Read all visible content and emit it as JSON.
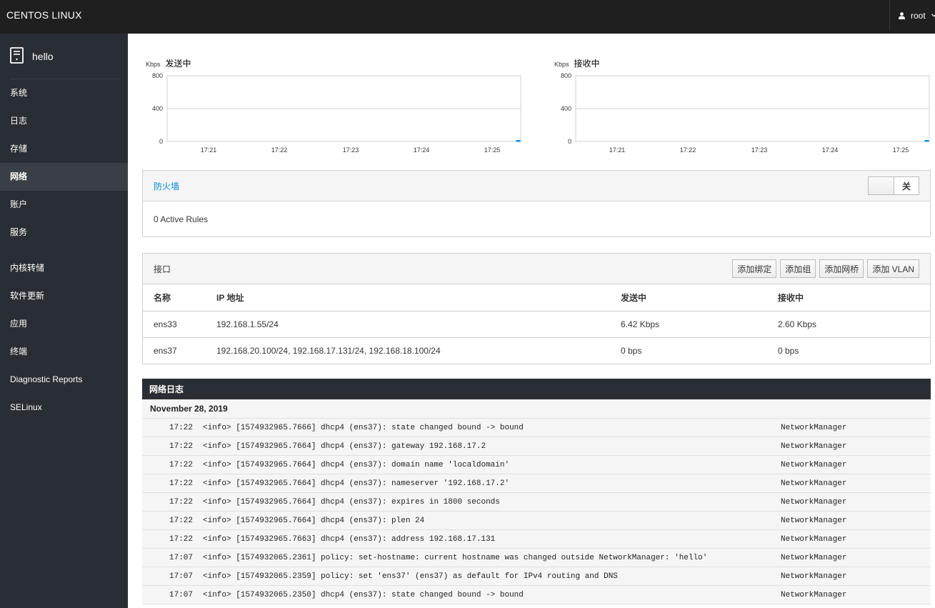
{
  "topbar": {
    "brand": "CENTOS LINUX",
    "user": "root"
  },
  "sidebar": {
    "host": "hello",
    "items": [
      "系统",
      "日志",
      "存储",
      "网络",
      "账户",
      "服务",
      "内核转储",
      "软件更新",
      "应用",
      "终端",
      "Diagnostic Reports",
      "SELinux"
    ],
    "active_index": 3
  },
  "charts": [
    {
      "unit": "Kbps",
      "title": "发送中",
      "chart_data": {
        "type": "area",
        "x": [
          "17:21",
          "17:22",
          "17:23",
          "17:24",
          "17:25"
        ],
        "yticks": [
          "800",
          "400",
          "0"
        ],
        "ylim": [
          0,
          800
        ],
        "grid": true,
        "values": [
          0,
          0,
          0,
          0,
          0,
          6.42
        ]
      }
    },
    {
      "unit": "Kbps",
      "title": "接收中",
      "chart_data": {
        "type": "area",
        "x": [
          "17:21",
          "17:22",
          "17:23",
          "17:24",
          "17:25"
        ],
        "yticks": [
          "800",
          "400",
          "0"
        ],
        "ylim": [
          0,
          800
        ],
        "grid": true,
        "values": [
          0,
          0,
          0,
          0,
          0,
          2.6
        ]
      }
    }
  ],
  "firewall": {
    "title": "防火墙",
    "toggle_label": "关",
    "rules": "0 Active Rules"
  },
  "interfaces": {
    "title": "接口",
    "buttons": [
      "添加绑定",
      "添加组",
      "添加网桥",
      "添加 VLAN"
    ],
    "columns": [
      "名称",
      "IP 地址",
      "发送中",
      "接收中"
    ],
    "rows": [
      [
        "ens33",
        "192.168.1.55/24",
        "6.42 Kbps",
        "2.60 Kbps"
      ],
      [
        "ens37",
        "192.168.20.100/24, 192.168.17.131/24, 192.168.18.100/24",
        "0 bps",
        "0 bps"
      ]
    ]
  },
  "log": {
    "title": "网络日志",
    "date": "November 28, 2019",
    "entries": [
      [
        "17:22",
        "<info> [1574932965.7666] dhcp4 (ens37): state changed bound -> bound",
        "NetworkManager"
      ],
      [
        "17:22",
        "<info> [1574932965.7664] dhcp4 (ens37): gateway 192.168.17.2",
        "NetworkManager"
      ],
      [
        "17:22",
        "<info> [1574932965.7664] dhcp4 (ens37): domain name 'localdomain'",
        "NetworkManager"
      ],
      [
        "17:22",
        "<info> [1574932965.7664] dhcp4 (ens37): nameserver '192.168.17.2'",
        "NetworkManager"
      ],
      [
        "17:22",
        "<info> [1574932965.7664] dhcp4 (ens37): expires in 1800 seconds",
        "NetworkManager"
      ],
      [
        "17:22",
        "<info> [1574932965.7664] dhcp4 (ens37): plen 24",
        "NetworkManager"
      ],
      [
        "17:22",
        "<info> [1574932965.7663] dhcp4 (ens37): address 192.168.17.131",
        "NetworkManager"
      ],
      [
        "17:07",
        "<info> [1574932065.2361] policy: set-hostname: current hostname was changed outside NetworkManager: 'hello'",
        "NetworkManager"
      ],
      [
        "17:07",
        "<info> [1574932065.2359] policy: set 'ens37' (ens37) as default for IPv4 routing and DNS",
        "NetworkManager"
      ],
      [
        "17:07",
        "<info> [1574932065.2350] dhcp4 (ens37): state changed bound -> bound",
        "NetworkManager"
      ]
    ]
  }
}
